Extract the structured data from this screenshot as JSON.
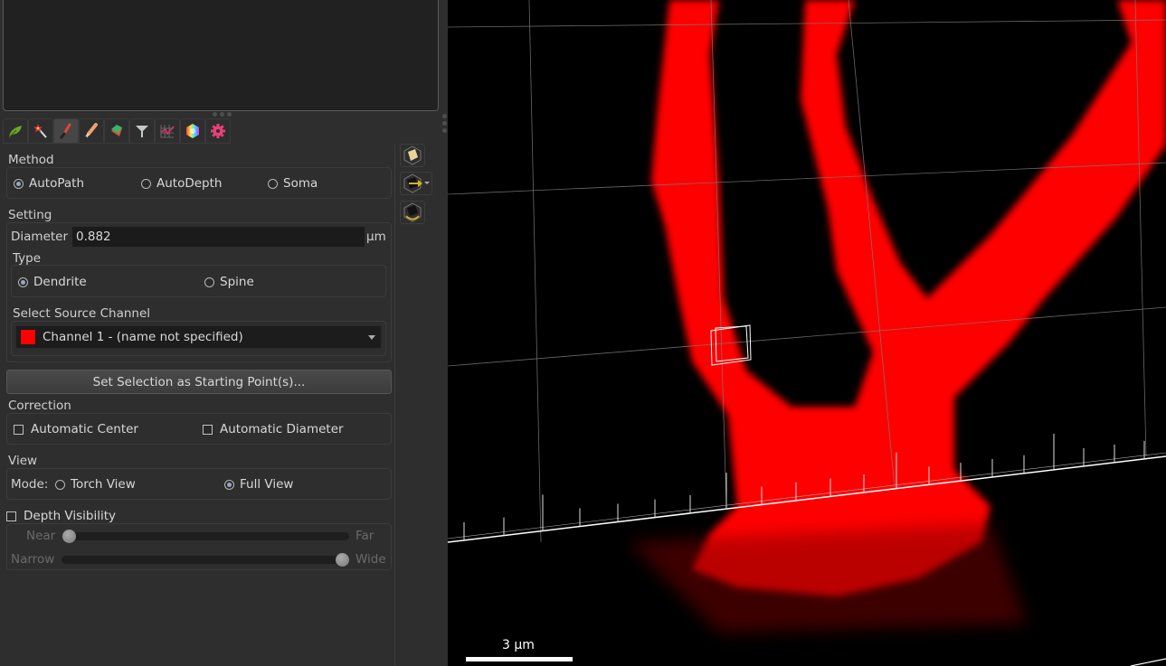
{
  "toolbar": {
    "tools": [
      {
        "name": "leaf",
        "active": false
      },
      {
        "name": "magic-wand",
        "active": false
      },
      {
        "name": "brush",
        "active": true
      },
      {
        "name": "pencil",
        "active": false
      },
      {
        "name": "tag",
        "active": false
      },
      {
        "name": "filter",
        "active": false
      },
      {
        "name": "chart-grid",
        "active": false
      },
      {
        "name": "color-wheel",
        "active": false
      },
      {
        "name": "gear",
        "active": false
      }
    ]
  },
  "side_tools": [
    {
      "name": "view-cube-icon"
    },
    {
      "name": "navigate-cube-icon",
      "has_dropdown": true
    },
    {
      "name": "rotate-cube-icon"
    }
  ],
  "method": {
    "label": "Method",
    "options": [
      "AutoPath",
      "AutoDepth",
      "Soma"
    ],
    "selected": "AutoPath"
  },
  "setting": {
    "label": "Setting",
    "diameter_label": "Diameter",
    "diameter_value": "0.882",
    "diameter_unit": "µm",
    "type_label": "Type",
    "type_options": [
      "Dendrite",
      "Spine"
    ],
    "type_selected": "Dendrite",
    "source_channel_label": "Select Source Channel",
    "source_channel_value": "Channel 1 - (name not specified)",
    "source_channel_color": "#ff0000"
  },
  "start_button_label": "Set Selection as Starting Point(s)...",
  "correction": {
    "label": "Correction",
    "options": [
      {
        "label": "Automatic Center",
        "checked": false
      },
      {
        "label": "Automatic Diameter",
        "checked": false
      }
    ]
  },
  "view": {
    "label": "View",
    "mode_label": "Mode:",
    "options": [
      "Torch View",
      "Full View"
    ],
    "selected": "Full View"
  },
  "depth_visibility": {
    "label": "Depth Visibility",
    "checked": false,
    "near_label": "Near",
    "far_label": "Far",
    "near_far_value": 0.0,
    "narrow_label": "Narrow",
    "wide_label": "Wide",
    "narrow_wide_value": 1.0
  },
  "viewport": {
    "scale_bar_label": "3 µm",
    "channel_color": "#ff0000"
  }
}
